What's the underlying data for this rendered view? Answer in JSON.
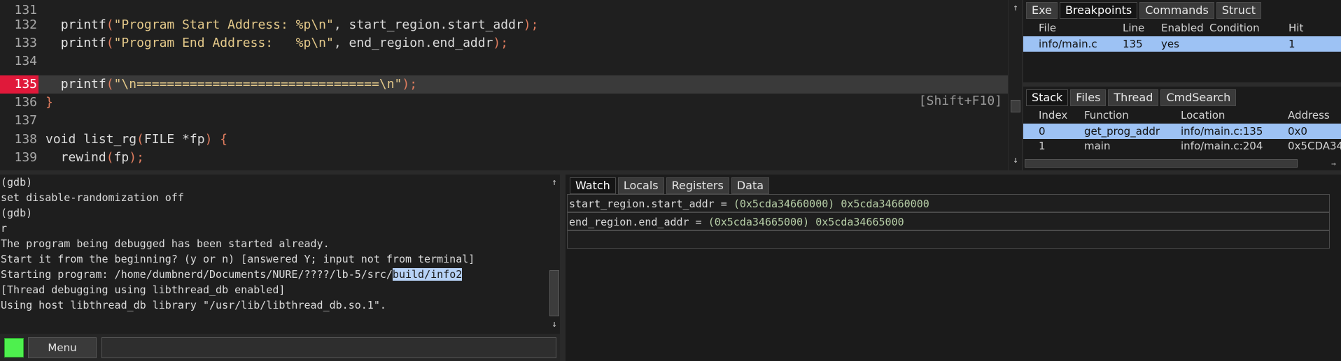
{
  "source": {
    "lines": [
      {
        "num": "131",
        "html_parts": []
      },
      {
        "num": "132"
      },
      {
        "num": "133"
      },
      {
        "num": "134"
      },
      {
        "num": "135"
      },
      {
        "num": "136"
      },
      {
        "num": "137"
      },
      {
        "num": "138"
      },
      {
        "num": "139"
      }
    ],
    "code": {
      "l132_indent": "  ",
      "l132_fn": "printf",
      "l132_str": "\"Program Start Address: %p\\n\"",
      "l132_rest": ", start_region.start_addr",
      "l132_end": ");",
      "l133_fn": "printf",
      "l133_str": "\"Program End Address:   %p\\n\"",
      "l133_rest": ", end_region.end_addr",
      "l133_end": ");",
      "l135_fn": "printf",
      "l135_str": "\"\\n================================\\n\"",
      "l135_end": ");",
      "l136": "}",
      "l138_a": "void list_rg",
      "l138_b": "(",
      "l138_c": "FILE *fp",
      "l138_d": ") {",
      "l139_a": "  rewind",
      "l139_b": "(",
      "l139_c": "fp",
      "l139_d": ");"
    },
    "hint": "[Shift+F10]"
  },
  "breakpoints_panel": {
    "tabs": [
      "Exe",
      "Breakpoints",
      "Commands",
      "Struct"
    ],
    "active_tab": "Breakpoints",
    "columns": [
      "File",
      "Line",
      "Enabled",
      "Condition",
      "Hit"
    ],
    "rows": [
      {
        "file": "info/main.c",
        "line": "135",
        "enabled": "yes",
        "condition": "",
        "hit": "1"
      }
    ]
  },
  "stack_panel": {
    "tabs": [
      "Stack",
      "Files",
      "Thread",
      "CmdSearch"
    ],
    "active_tab": "Stack",
    "columns": [
      "Index",
      "Function",
      "Location",
      "Address"
    ],
    "rows": [
      {
        "index": "0",
        "function": "get_prog_addr",
        "location": "info/main.c:135",
        "address": "0x0"
      },
      {
        "index": "1",
        "function": "main",
        "location": "info/main.c:204",
        "address": "0x5CDA34"
      }
    ]
  },
  "console": {
    "lines": [
      "(gdb)",
      "set disable-randomization off",
      "(gdb)",
      "r",
      "The program being debugged has been started already.",
      "Start it from the beginning? (y or n) [answered Y; input not from terminal]",
      "[Thread debugging using libthread_db enabled]",
      "Using host libthread_db library \"/usr/lib/libthread_db.so.1\"."
    ],
    "starting_prefix": "Starting program: /home/dumbnerd/Documents/NURE/????/lb-5/src/",
    "starting_selected": "build/info2",
    "menu_label": "Menu",
    "input_value": "",
    "input_placeholder": ""
  },
  "watch_panel": {
    "tabs": [
      "Watch",
      "Locals",
      "Registers",
      "Data"
    ],
    "active_tab": "Watch",
    "rows": [
      {
        "expr": "start_region.start_addr",
        "eq": " = ",
        "typed": "(0x5cda34660000)",
        "value": " 0x5cda34660000"
      },
      {
        "expr": "end_region.end_addr",
        "eq": " = ",
        "typed": "(0x5cda34665000)",
        "value": " 0x5cda34665000"
      },
      {
        "expr": "",
        "eq": "",
        "typed": "",
        "value": ""
      }
    ]
  },
  "colors": {
    "breakpoint_marker": "#e0193a",
    "status_indicator": "#4ef04e",
    "selection": "#9dc2f4"
  }
}
